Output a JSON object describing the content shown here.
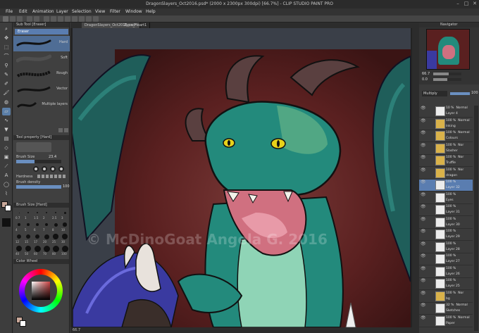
{
  "window": {
    "title": "DragonSlayers_Oct2016.psd* (2000 x 2300px 300dpi) [66.7%] - CLIP STUDIO PAINT PRO"
  },
  "menu": [
    "File",
    "Edit",
    "Animation",
    "Layer",
    "Selection",
    "View",
    "Filter",
    "Window",
    "Help"
  ],
  "canvas_tabs": [
    "DragonSlayers_Oct2016.psd*",
    "Zyon_Heart1"
  ],
  "subtool": {
    "header": "Sub Tool [Eraser]",
    "title": "Eraser",
    "brushes": [
      "Hard",
      "Soft",
      "Rough",
      "Vector",
      "Multiple layers"
    ]
  },
  "tool_property": {
    "header": "Tool property [Hard]",
    "brush_size_label": "Brush Size",
    "brush_size_value": "23.4",
    "hardness_label": "Hardness",
    "density_label": "Brush density",
    "density_value": "100"
  },
  "brush_size_panel": {
    "header": "Brush Size [Hard]",
    "sizes": [
      "0.7",
      "1",
      "1.5",
      "2",
      "2.5",
      "3",
      "4",
      "5",
      "6",
      "7",
      "8",
      "10",
      "12",
      "15",
      "17",
      "20",
      "25",
      "30",
      "40",
      "50",
      "60",
      "70",
      "80",
      "100"
    ]
  },
  "color_panel": {
    "header": "Color Wheel"
  },
  "navigator": {
    "header": "Navigator",
    "zoom": "66.7",
    "rotation": "0.0"
  },
  "layers": {
    "blend_mode": "Multiply",
    "opacity": "100",
    "items": [
      {
        "opacity": "10 %",
        "mode": "Normal",
        "name": "Layer 4"
      },
      {
        "opacity": "100 %",
        "mode": "Normal",
        "name": "Inking"
      },
      {
        "opacity": "100 %",
        "mode": "Normal",
        "name": "Colours"
      },
      {
        "opacity": "100 %",
        "mode": "Nor",
        "name": "Slasher"
      },
      {
        "opacity": "100 %",
        "mode": "Nor",
        "name": "Truffle"
      },
      {
        "opacity": "100 %",
        "mode": "Nor",
        "name": "dragon"
      },
      {
        "opacity": "100 %",
        "mode": "",
        "name": "Layer 32"
      },
      {
        "opacity": "100 %",
        "mode": "",
        "name": "Eyes"
      },
      {
        "opacity": "100 %",
        "mode": "",
        "name": "Layer 31"
      },
      {
        "opacity": "100 %",
        "mode": "",
        "name": "Layer 30"
      },
      {
        "opacity": "100 %",
        "mode": "",
        "name": "Layer 29"
      },
      {
        "opacity": "100 %",
        "mode": "",
        "name": "Layer 28"
      },
      {
        "opacity": "100 %",
        "mode": "",
        "name": "Layer 27"
      },
      {
        "opacity": "100 %",
        "mode": "",
        "name": "Layer 26"
      },
      {
        "opacity": "100 %",
        "mode": "",
        "name": "Layer 25"
      },
      {
        "opacity": "100 %",
        "mode": "Nor",
        "name": "bg"
      },
      {
        "opacity": "32 %",
        "mode": "Normal",
        "name": "Sketches"
      },
      {
        "opacity": "100 %",
        "mode": "Normal",
        "name": "Paper"
      }
    ]
  },
  "watermark": "© McDinoGoat Angela G. 2016",
  "status": {
    "zoom": "66.7"
  }
}
